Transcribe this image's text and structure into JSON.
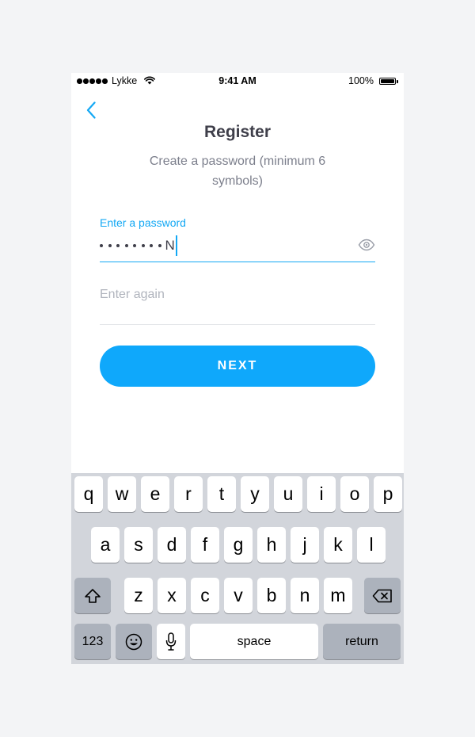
{
  "status_bar": {
    "carrier": "Lykke",
    "time": "9:41 AM",
    "battery": "100%"
  },
  "page": {
    "title": "Register",
    "subtitle": "Create a password (minimum 6 symbols)"
  },
  "password_field": {
    "label": "Enter a password",
    "masked_count": 8,
    "last_char": "N"
  },
  "confirm_field": {
    "placeholder": "Enter again"
  },
  "next_button": {
    "label": "NEXT"
  },
  "colors": {
    "accent": "#13a8f4",
    "button": "#0fa8fb",
    "title": "#3f3f4a",
    "subtitle": "#7c7f8c",
    "keyboard_bg": "#d2d5db"
  },
  "keyboard": {
    "row1": [
      "q",
      "w",
      "e",
      "r",
      "t",
      "y",
      "u",
      "i",
      "o",
      "p"
    ],
    "row2": [
      "a",
      "s",
      "d",
      "f",
      "g",
      "h",
      "j",
      "k",
      "l"
    ],
    "row3": [
      "z",
      "x",
      "c",
      "v",
      "b",
      "n",
      "m"
    ],
    "numbers_label": "123",
    "space_label": "space",
    "return_label": "return",
    "shift_icon": "shift-icon",
    "delete_icon": "delete-icon",
    "emoji_icon": "emoji-icon",
    "mic_icon": "microphone-icon"
  }
}
